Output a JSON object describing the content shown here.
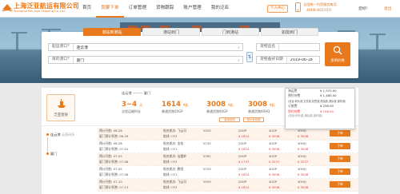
{
  "header": {
    "logo_cn": "上海泛亚航运有限公司",
    "logo_en": "Shanghai Pan-Asia Shipping Co.,Ltd",
    "nav": [
      "首页",
      "我要下单",
      "订单管理",
      "货物跟踪",
      "账户管理",
      "我的泛亚"
    ],
    "active_nav": 1,
    "user_center": "个人中心",
    "hotline_label": "全国统一内贸服务电话",
    "hotline_number": "4008-601010",
    "welcome": "您好！",
    "logout": "退出",
    "accent_color": "#e7791c"
  },
  "search": {
    "tabs": [
      "港站到港站",
      "港站到门",
      "门到港站",
      "如需到门"
    ],
    "active_tab": 0,
    "origin_label": "起运港口*",
    "origin_value": "连云港",
    "dest_label": "目的港口*",
    "dest_value": "厦门",
    "cargo_label": "货物品名",
    "cargo_value": "",
    "date_label": "货物备好日期",
    "date_value": "2019-06-18",
    "search_button": "查询价格",
    "swap_icon": "swap-icon"
  },
  "route_card": {
    "brand": "泛亚直快",
    "route_text": "连云港 ——— 厦门",
    "transit": "3~4",
    "transit_unit": "天",
    "transit_label": "全程运输时长",
    "price_20gp": "1614",
    "price_20gp_label": "普通货物20GP",
    "price_40gp": "3008",
    "price_40gp_label": "普通货物40GP",
    "price_40hq": "3008",
    "price_40hq_label": "普通货物40HQ",
    "currency_unit": "¥起",
    "tag1": "费用说明",
    "tag2": "报价有效期"
  },
  "price_popup": {
    "rows": [
      {
        "k": "海运费",
        "v": "¥ 1,370.00"
      },
      {
        "k": "预付杂费",
        "v": "¥ 1,480.00"
      },
      {
        "k": "(包含:码头费,文件费,封签费,燃油费,港杂费,操作费)",
        "v": ""
      },
      {
        "k": "订舱费",
        "v": "¥ 236.00"
      },
      {
        "k": "到付杂费",
        "v": "¥ 156.00"
      }
    ],
    "red_row": 4,
    "note": "(包含:码头费,港杂费,操作费)"
  },
  "ports": {
    "from": "连云港",
    "from_sub": "泛亚码头",
    "to": "厦门"
  },
  "voyages": [
    {
      "cut": "预计开航: 06-26",
      "arr": "厦门预计到港: 06-29",
      "ship": "船名航次: 飞云河",
      "voy": "2925",
      "svc": "航线: CF3",
      "c1": "20GP",
      "c2": "40GP",
      "c3": "40HQ",
      "p1": "¥ 1614",
      "p2": "¥ 3008",
      "p3": "¥ 3008",
      "book": "下单"
    },
    {
      "cut": "预计开航: 06-28",
      "arr": "厦门预计到港: 07-01",
      "ship": "船名航次: 金桂",
      "voy": "0745",
      "svc": "航线: CF1",
      "c1": "20GP",
      "c2": "40GP",
      "c3": "40HQ",
      "p1": "¥ 1614",
      "p2": "¥ 3008",
      "p3": "¥ 3008",
      "book": "下单"
    },
    {
      "cut": "预计开航: 07-03",
      "arr": "厦门预计到港: 07-06",
      "ship": "船名航次: 仙霞岭",
      "voy": "0761",
      "svc": "航线: CF3",
      "c1": "20GP",
      "c2": "40GP",
      "c3": "40HQ",
      "p1": "¥ 1737",
      "p2": "¥ 3237",
      "p3": "¥ 3237",
      "book": "下单"
    },
    {
      "cut": "预计开航: 07-05",
      "arr": "厦门预计到港: 07-08",
      "ship": "船名航次: 鹏程",
      "voy": "0753",
      "svc": "航线: CF1",
      "c1": "20GP",
      "c2": "40GP",
      "c3": "40HQ",
      "p1": "¥ 1614",
      "p2": "¥ 3008",
      "p3": "¥ 3008",
      "book": "下单"
    },
    {
      "cut": "预计开航: 07-10",
      "arr": "厦门预计到港: 07-13",
      "ship": "船名航次: 飞云河",
      "voy": "2929",
      "svc": "航线: CF3",
      "c1": "20GP",
      "c2": "40GP",
      "c3": "40HQ",
      "p1": "¥ 1614",
      "p2": "¥ 3008",
      "p3": "¥ 3008",
      "book": "下单"
    }
  ]
}
